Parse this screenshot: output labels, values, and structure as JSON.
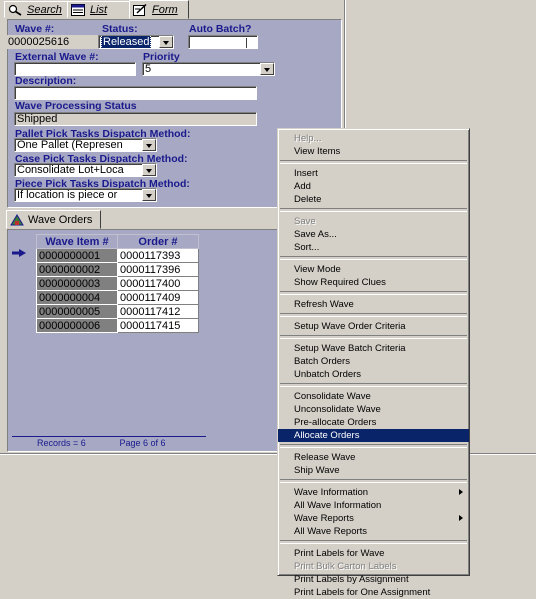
{
  "tabs": [
    {
      "label": "Search",
      "icon": "search-icon"
    },
    {
      "label": "List",
      "icon": "list-icon"
    },
    {
      "label": "Form",
      "icon": "form-icon"
    }
  ],
  "form": {
    "wave_label": "Wave #:",
    "wave_value": "0000025616",
    "status_label": "Status:",
    "status_value": "Released",
    "auto_batch_label": "Auto Batch?",
    "auto_batch_value": "",
    "external_wave_label": "External Wave #:",
    "external_wave_value": "",
    "priority_label": "Priority",
    "priority_value": "5",
    "description_label": "Description:",
    "description_value": "",
    "processing_status_label": "Wave Processing Status",
    "processing_status_value": "Shipped",
    "pallet_label": "Pallet Pick Tasks Dispatch Method:",
    "pallet_value": "One Pallet (Represen",
    "case_label": "Case Pick Tasks Dispatch Method:",
    "case_value": "Consolidate Lot+Loca",
    "piece_label": "Piece Pick Tasks Dispatch Method:",
    "piece_value": "If location is piece or"
  },
  "wave_orders": {
    "tab_label": "Wave Orders",
    "columns": [
      "Wave Item #",
      "Order #"
    ],
    "rows": [
      [
        "0000000001",
        "0000117393"
      ],
      [
        "0000000002",
        "0000117396"
      ],
      [
        "0000000003",
        "0000117400"
      ],
      [
        "0000000004",
        "0000117409"
      ],
      [
        "0000000005",
        "0000117412"
      ],
      [
        "0000000006",
        "0000117415"
      ]
    ],
    "records": "Records = 6",
    "page": "Page 6 of 6"
  },
  "menu": {
    "items": [
      {
        "label": "Help...",
        "disabled": true
      },
      {
        "label": "View Items"
      },
      {
        "sep": true
      },
      {
        "label": "Insert"
      },
      {
        "label": "Add"
      },
      {
        "label": "Delete"
      },
      {
        "sep": true
      },
      {
        "label": "Save",
        "disabled": true
      },
      {
        "label": "Save As..."
      },
      {
        "label": "Sort..."
      },
      {
        "sep": true
      },
      {
        "label": "View Mode"
      },
      {
        "label": "Show Required Clues"
      },
      {
        "sep": true
      },
      {
        "label": "Refresh Wave"
      },
      {
        "sep": true
      },
      {
        "label": "Setup Wave Order Criteria"
      },
      {
        "sep": true
      },
      {
        "label": "Setup Wave Batch Criteria"
      },
      {
        "label": "Batch Orders"
      },
      {
        "label": "Unbatch Orders"
      },
      {
        "sep": true
      },
      {
        "label": "Consolidate Wave"
      },
      {
        "label": "Unconsolidate Wave"
      },
      {
        "label": "Pre-allocate Orders"
      },
      {
        "label": "Allocate Orders",
        "selected": true
      },
      {
        "sep": true
      },
      {
        "label": "Release Wave"
      },
      {
        "label": "Ship Wave"
      },
      {
        "sep": true
      },
      {
        "label": "Wave Information",
        "submenu": true
      },
      {
        "label": "All Wave Information"
      },
      {
        "label": "Wave Reports",
        "submenu": true
      },
      {
        "label": "All Wave Reports"
      },
      {
        "sep": true
      },
      {
        "label": "Print Labels for Wave"
      },
      {
        "label": "Print Bulk Carton Labels",
        "disabled": true
      },
      {
        "label": "Print Labels by Assignment"
      },
      {
        "label": "Print Labels for One Assignment"
      }
    ]
  },
  "colors": {
    "panel": "#a6a8c4",
    "label": "#1a1a8c",
    "selection": "#0a246a"
  }
}
